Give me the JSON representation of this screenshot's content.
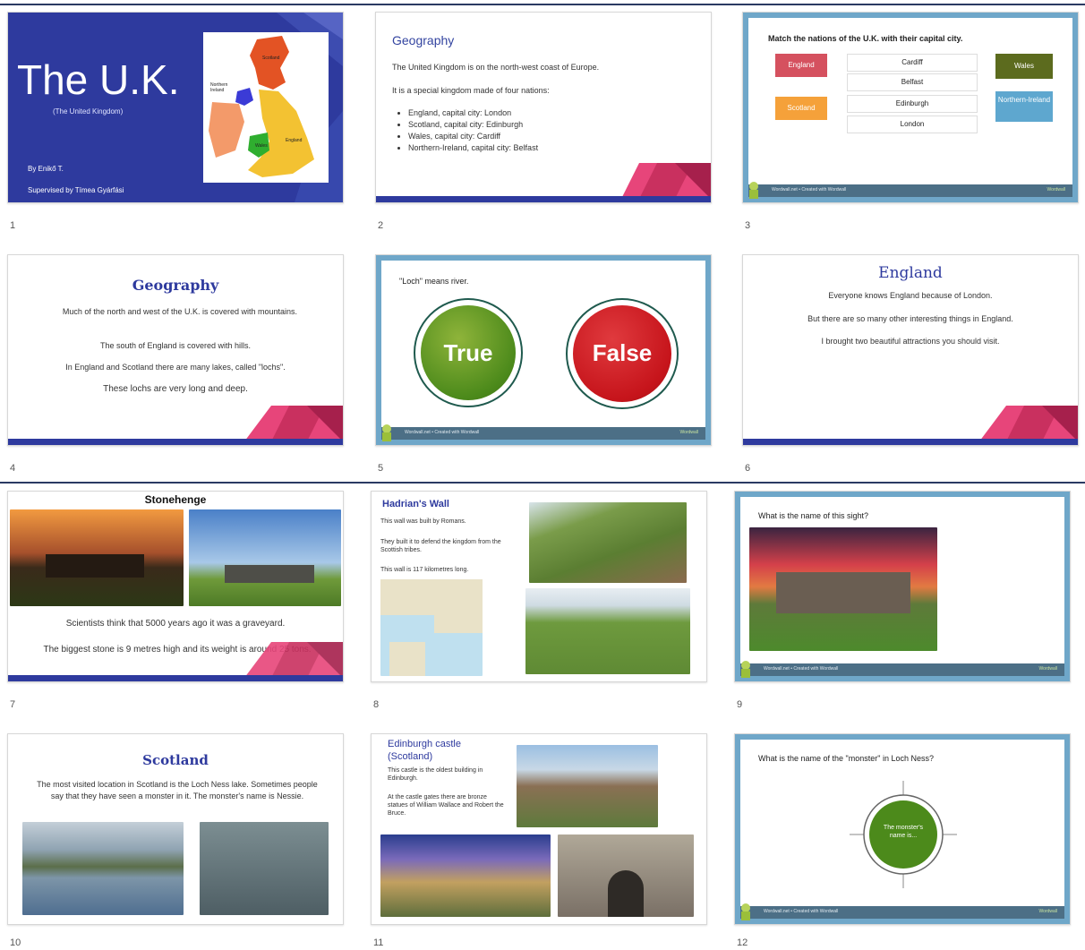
{
  "slides": {
    "s1": {
      "number": "1",
      "title": "The U.K.",
      "subtitle": "(The United Kingdom)",
      "author": "By Enikő T.",
      "supervisor": "Supervised by Tímea Gyárfási",
      "map_labels": {
        "scotland": "Scotland",
        "northern_ireland": "Northern Ireland",
        "wales": "Wales",
        "england": "England"
      }
    },
    "s2": {
      "number": "2",
      "title": "Geography",
      "p1": "The United Kingdom is on the north-west coast of Europe.",
      "p2": "It is a special kingdom made of four nations:",
      "bullets": [
        "England, capital city: London",
        "Scotland, capital city: Edinburgh",
        "Wales, capital city: Cardiff",
        "Northern-Ireland, capital city: Belfast"
      ]
    },
    "s3": {
      "number": "3",
      "title": "Match the nations of the U.K. with their capital city.",
      "left": [
        "England",
        "Scotland"
      ],
      "cities": [
        "Cardiff",
        "Belfast",
        "Edinburgh",
        "London"
      ],
      "right": [
        "Wales",
        "Northern-Ireland"
      ],
      "footer": "Wordwall.net • Created with Wordwall",
      "footer_right": "Wordwall"
    },
    "s4": {
      "number": "4",
      "title": "Geography",
      "p1": "Much of the north and west of the U.K. is covered with mountains.",
      "p2": "The south of England is covered with hills.",
      "p3": "In England and Scotland there are many lakes, called \"lochs\".",
      "p4": "These lochs are very long and deep."
    },
    "s5": {
      "number": "5",
      "question": "\"Loch\" means river.",
      "true_label": "True",
      "false_label": "False",
      "footer": "Wordwall.net • Created with Wordwall",
      "footer_right": "Wordwall"
    },
    "s6": {
      "number": "6",
      "title": "England",
      "p1": "Everyone knows England because of London.",
      "p2": "But there are so many other interesting things in England.",
      "p3": "I brought two beautiful attractions you should visit."
    },
    "s7": {
      "number": "7",
      "title": "Stonehenge",
      "p1": "Scientists think that 5000 years ago it was a graveyard.",
      "p2": "The biggest stone is 9 metres high and its weight is around 25 tons."
    },
    "s8": {
      "number": "8",
      "title": "Hadrian's Wall",
      "p1": "This wall was built by Romans.",
      "p2": "They built it to defend the kingdom from the Scottish tribes.",
      "p3": "This wall is 117 kilometres long."
    },
    "s9": {
      "number": "9",
      "question": "What is the name of this sight?",
      "footer": "Wordwall.net • Created with Wordwall",
      "footer_right": "Wordwall"
    },
    "s10": {
      "number": "10",
      "title": "Scotland",
      "p1": "The most visited location in Scotland is the Loch Ness lake. Sometimes people say that they have seen a monster in it. The monster's name is Nessie."
    },
    "s11": {
      "number": "11",
      "title": "Edinburgh castle (Scotland)",
      "p1": "This castle is the oldest building in Edinburgh.",
      "p2": "At the castle gates there are bronze statues of William Wallace and Robert the Bruce."
    },
    "s12": {
      "number": "12",
      "question": "What is the name of the \"monster\" in Loch Ness?",
      "answer": "The monster's name is...",
      "footer": "Wordwall.net • Created with Wordwall",
      "footer_right": "Wordwall"
    }
  },
  "colors": {
    "navy": "#2e3a9e",
    "pink": "#e7457a",
    "frame": "#6fa7c9",
    "green": "#4c8a1b",
    "red": "#c6141b",
    "olive": "#5c6b1e",
    "lightblue": "#5ea7cf",
    "orange": "#f5a13a",
    "rosered": "#d5515f"
  }
}
